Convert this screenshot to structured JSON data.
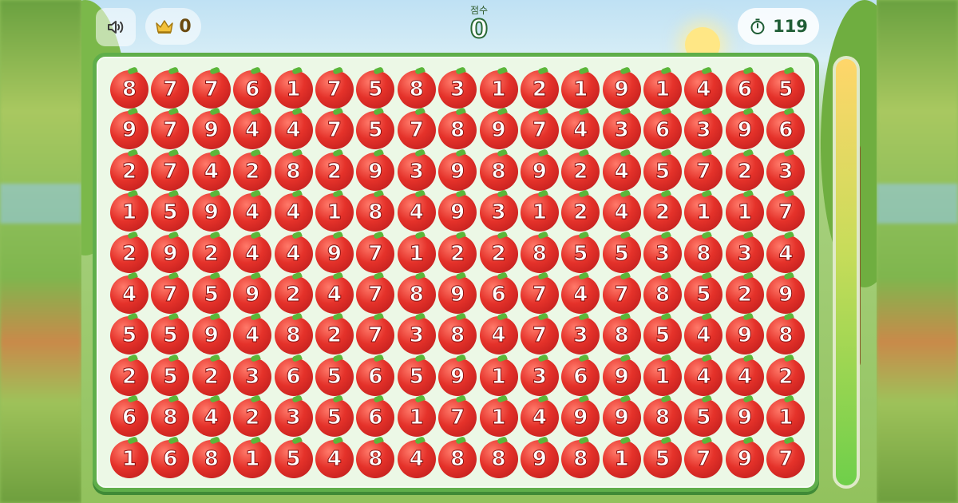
{
  "header": {
    "sound_icon": "speaker-icon",
    "crown_icon": "crown-icon",
    "best_score": "0",
    "score_label": "점수",
    "score": "0",
    "timer_icon": "stopwatch-icon",
    "time_left": "119"
  },
  "board": {
    "rows": [
      [
        "8",
        "7",
        "7",
        "6",
        "1",
        "7",
        "5",
        "8",
        "3",
        "1",
        "2",
        "1",
        "9",
        "1",
        "4",
        "6",
        "5"
      ],
      [
        "9",
        "7",
        "9",
        "4",
        "4",
        "7",
        "5",
        "7",
        "8",
        "9",
        "7",
        "4",
        "3",
        "6",
        "3",
        "9",
        "6"
      ],
      [
        "2",
        "7",
        "4",
        "2",
        "8",
        "2",
        "9",
        "3",
        "9",
        "8",
        "9",
        "2",
        "4",
        "5",
        "7",
        "2",
        "3"
      ],
      [
        "1",
        "5",
        "9",
        "4",
        "4",
        "1",
        "8",
        "4",
        "9",
        "3",
        "1",
        "2",
        "4",
        "2",
        "1",
        "1",
        "7"
      ],
      [
        "2",
        "9",
        "2",
        "4",
        "4",
        "9",
        "7",
        "1",
        "2",
        "2",
        "8",
        "5",
        "5",
        "3",
        "8",
        "3",
        "4"
      ],
      [
        "4",
        "7",
        "5",
        "9",
        "2",
        "4",
        "7",
        "8",
        "9",
        "6",
        "7",
        "4",
        "7",
        "8",
        "5",
        "2",
        "9"
      ],
      [
        "5",
        "5",
        "9",
        "4",
        "8",
        "2",
        "7",
        "3",
        "8",
        "4",
        "7",
        "3",
        "8",
        "5",
        "4",
        "9",
        "8"
      ],
      [
        "2",
        "5",
        "2",
        "3",
        "6",
        "5",
        "6",
        "5",
        "9",
        "1",
        "3",
        "6",
        "9",
        "1",
        "4",
        "4",
        "2"
      ],
      [
        "6",
        "8",
        "4",
        "2",
        "3",
        "5",
        "6",
        "1",
        "7",
        "1",
        "4",
        "9",
        "9",
        "8",
        "5",
        "9",
        "1"
      ],
      [
        "1",
        "6",
        "8",
        "1",
        "5",
        "4",
        "8",
        "4",
        "8",
        "8",
        "9",
        "8",
        "1",
        "5",
        "7",
        "9",
        "7"
      ]
    ]
  },
  "time_bar": {
    "fill_fraction": 1.0
  },
  "colors": {
    "apple": "#e5322a",
    "board_border": "#5fae4a",
    "timer_text": "#1f5d35"
  }
}
